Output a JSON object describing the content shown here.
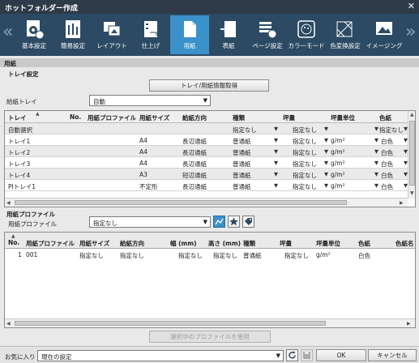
{
  "window": {
    "title": "ホットフォルダー作成"
  },
  "toolbar": {
    "tabs": [
      {
        "label": "基本設定",
        "icon": "basic-settings-icon"
      },
      {
        "label": "簡易設定",
        "icon": "easy-settings-icon"
      },
      {
        "label": "レイアウト",
        "icon": "layout-icon"
      },
      {
        "label": "仕上げ",
        "icon": "finishing-icon"
      },
      {
        "label": "用紙",
        "icon": "paper-icon",
        "active": true
      },
      {
        "label": "表紙",
        "icon": "cover-icon"
      },
      {
        "label": "ページ設定",
        "icon": "page-settings-icon"
      },
      {
        "label": "カラーモード",
        "icon": "color-mode-icon"
      },
      {
        "label": "色変換設定",
        "icon": "color-conversion-icon"
      },
      {
        "label": "イメージング",
        "icon": "imaging-icon"
      }
    ]
  },
  "paper": {
    "section_title": "用紙",
    "tray_settings": {
      "title": "トレイ設定",
      "get_info_button": "トレイ/用紙情報取得",
      "feed_tray_label": "給紙トレイ",
      "feed_tray_value": "自動",
      "columns": [
        "トレイ",
        "No.",
        "用紙プロファイル",
        "用紙サイズ",
        "給紙方向",
        "種類",
        "坪量",
        "坪量単位",
        "色紙"
      ],
      "rows": [
        {
          "tray": "自動選択",
          "no": "",
          "profile": "",
          "size": "",
          "direction": "",
          "type": "指定なし",
          "weight": "指定なし",
          "unit": "",
          "color": "指定なし"
        },
        {
          "tray": "トレイ1",
          "no": "",
          "profile": "",
          "size": "A4",
          "direction": "長辺通紙",
          "type": "普通紙",
          "weight": "指定なし",
          "unit": "g/m²",
          "color": "白色"
        },
        {
          "tray": "トレイ2",
          "no": "",
          "profile": "",
          "size": "A4",
          "direction": "長辺通紙",
          "type": "普通紙",
          "weight": "指定なし",
          "unit": "g/m²",
          "color": "白色"
        },
        {
          "tray": "トレイ3",
          "no": "",
          "profile": "",
          "size": "A4",
          "direction": "長辺通紙",
          "type": "普通紙",
          "weight": "指定なし",
          "unit": "g/m²",
          "color": "白色"
        },
        {
          "tray": "トレイ4",
          "no": "",
          "profile": "",
          "size": "A3",
          "direction": "短辺通紙",
          "type": "普通紙",
          "weight": "指定なし",
          "unit": "g/m²",
          "color": "白色"
        },
        {
          "tray": "PIトレイ1",
          "no": "",
          "profile": "",
          "size": "不定形",
          "direction": "長辺通紙",
          "type": "普通紙",
          "weight": "指定なし",
          "unit": "g/m²",
          "color": "白色"
        }
      ]
    },
    "profile": {
      "title": "用紙プロファイル",
      "label": "用紙プロファイル",
      "value": "指定なし",
      "columns": [
        "No.",
        "用紙プロファイル",
        "用紙サイズ",
        "給紙方向",
        "幅 (mm)",
        "高さ (mm)",
        "種類",
        "坪量",
        "坪量単位",
        "色紙",
        "色紙名"
      ],
      "rows": [
        {
          "no": "1",
          "profile": "001",
          "size": "指定なし",
          "direction": "指定なし",
          "width": "指定なし",
          "height": "指定なし",
          "type": "普通紙",
          "weight": "指定なし",
          "unit": "g/m²",
          "color": "白色",
          "color_name": ""
        }
      ],
      "use_button": "選択中のプロファイルを使用"
    }
  },
  "footer": {
    "favorites_label": "お気に入り",
    "favorites_value": "現在の設定",
    "ok_label": "OK",
    "cancel_label": "キャンセル"
  }
}
